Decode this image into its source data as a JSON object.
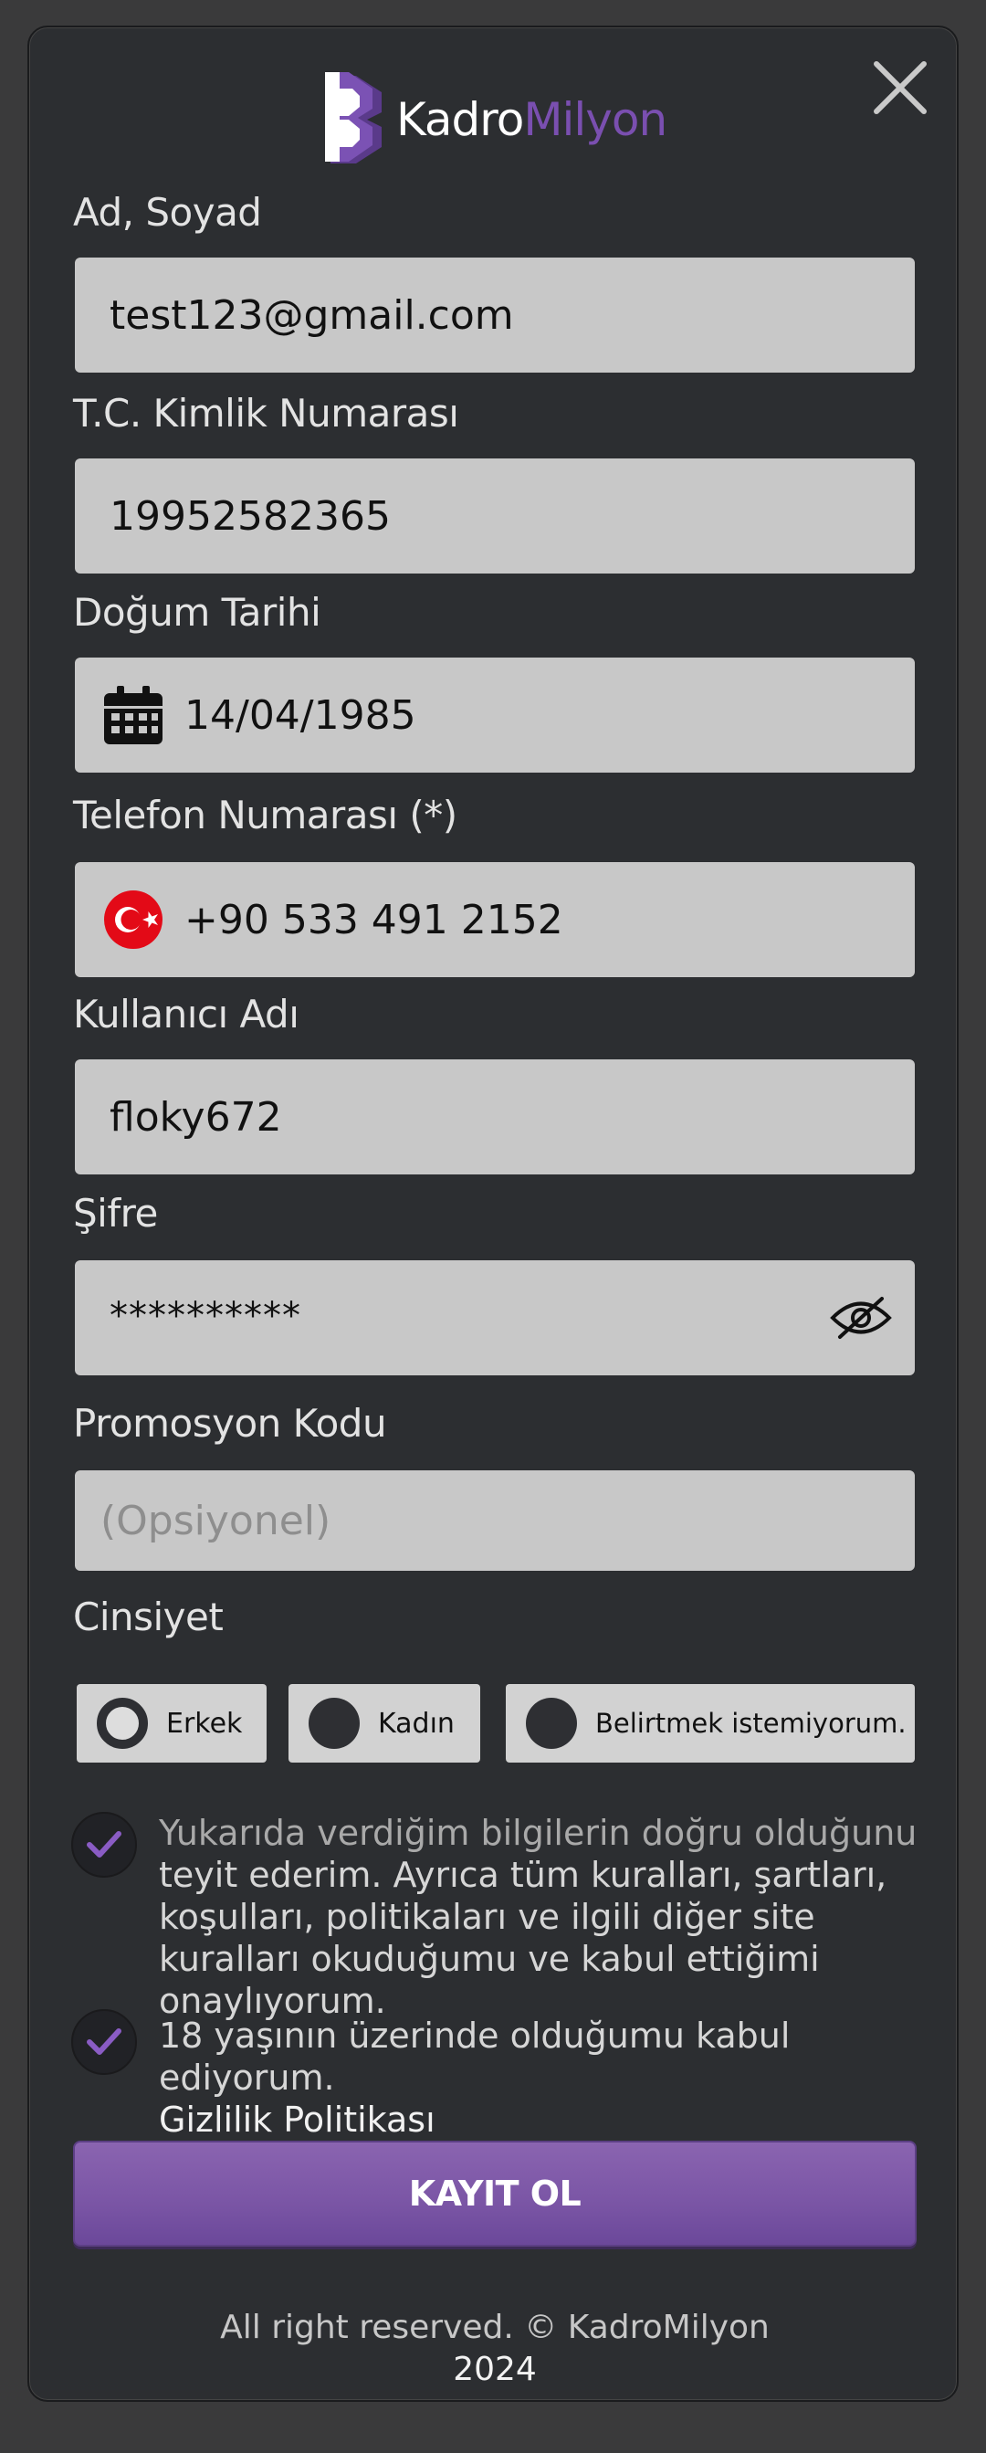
{
  "brand": {
    "name_part1": "Kadro",
    "name_part2": "Milyon",
    "accent": "#7a4fb0"
  },
  "form": {
    "name": {
      "label": "Ad, Soyad",
      "value": "test123@gmail.com"
    },
    "tc": {
      "label": "T.C. Kimlik Numarası",
      "value": "19952582365"
    },
    "birth": {
      "label": "Doğum Tarihi",
      "value": "14/04/1985",
      "icon": "calendar-icon"
    },
    "phone": {
      "label": "Telefon Numarası (*)",
      "value": "+90 533 491 2152",
      "icon": "turkey-flag-icon"
    },
    "username": {
      "label": "Kullanıcı Adı",
      "value": "floky672"
    },
    "password": {
      "label": "Şifre",
      "value": "**********",
      "icon": "eye-off-icon"
    },
    "promo": {
      "label": "Promosyon Kodu",
      "placeholder": "(Opsiyonel)"
    },
    "gender": {
      "label": "Cinsiyet",
      "options": [
        "Erkek",
        "Kadın",
        "Belirtmek istemiyorum."
      ],
      "selected": "Erkek"
    }
  },
  "consents": {
    "terms_part1": "Yukarıda verdiğim bilgilerin doğru olduğunu",
    "terms_part2": "teyit ederim. Ayrıca tüm kuralları, şartları, koşulları, politikaları ve ilgili diğer site kuralları okuduğumu ve kabul ettiğimi onaylıyorum.",
    "age": "18 yaşının üzerinde olduğumu kabul ediyorum.",
    "privacy_link": "Gizlilik Politikası"
  },
  "submit_label": "KAYIT OL",
  "footer": {
    "rights": "All right reserved. © KadroMilyon",
    "year": "2024"
  }
}
